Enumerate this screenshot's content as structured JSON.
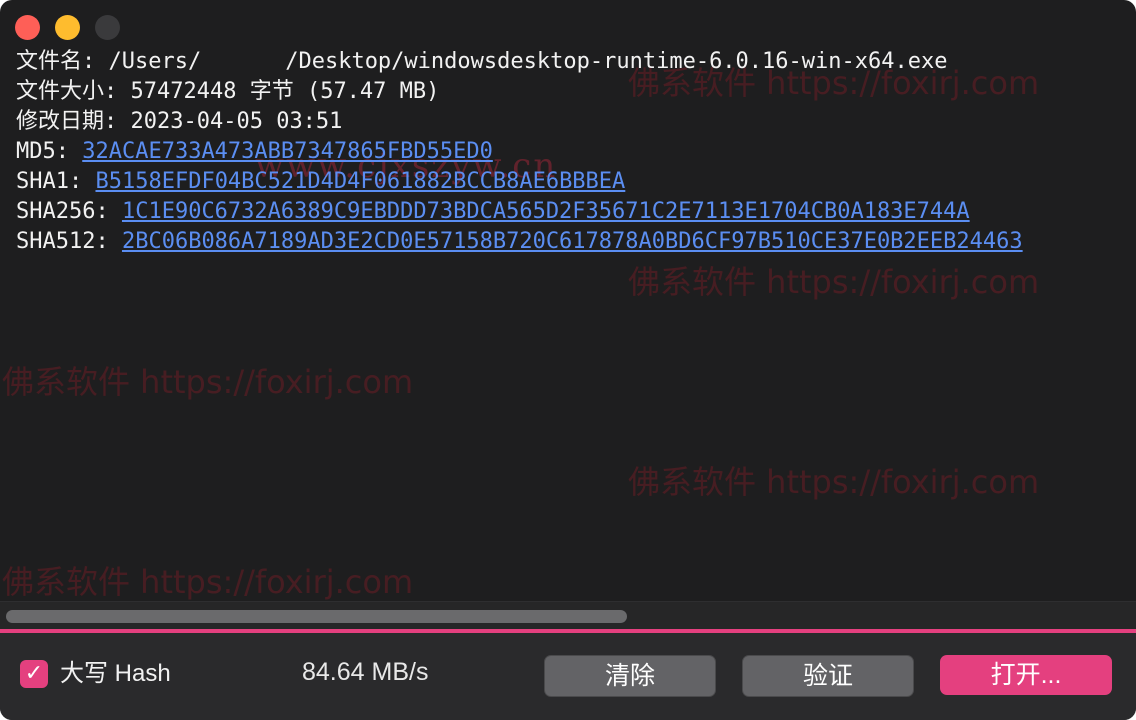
{
  "window": {
    "controls": [
      "close",
      "minimize",
      "maximize"
    ]
  },
  "result": {
    "filename_label": "文件名:",
    "filename_prefix": "/Users/",
    "filename_suffix": "/Desktop/windowsdesktop-runtime-6.0.16-win-x64.exe",
    "size_label": "文件大小:",
    "size_value": "57472448 字节 (57.47 MB)",
    "date_label": "修改日期:",
    "date_value": "2023-04-05 03:51",
    "md5_label": "MD5:",
    "md5_value": "32ACAE733A473ABB7347865FBD55ED0",
    "sha1_label": "SHA1:",
    "sha1_value": "B5158EFDF04BC521D4D4F061882BCCB8AE6BBBEA",
    "sha256_label": "SHA256:",
    "sha256_value": "1C1E90C6732A6389C9EBDDD73BDCA565D2F35671C2E7113E1704CB0A183E744A",
    "sha512_label": "SHA512:",
    "sha512_value": "2BC06B086A7189AD3E2CD0E57158B720C617878A0BD6CF97B510CE37E0B2EEB24463"
  },
  "watermarks": {
    "brand": "佛系软件 https://foxirj.com",
    "site": "www.cjxszyw.cn"
  },
  "footer": {
    "uppercase_label": "大写 Hash",
    "uppercase_checked": true,
    "speed": "84.64 MB/s",
    "clear_label": "清除",
    "verify_label": "验证",
    "open_label": "打开..."
  },
  "colors": {
    "accent": "#e4407f",
    "link": "#5b8ef2",
    "background": "#1e1e1f"
  }
}
